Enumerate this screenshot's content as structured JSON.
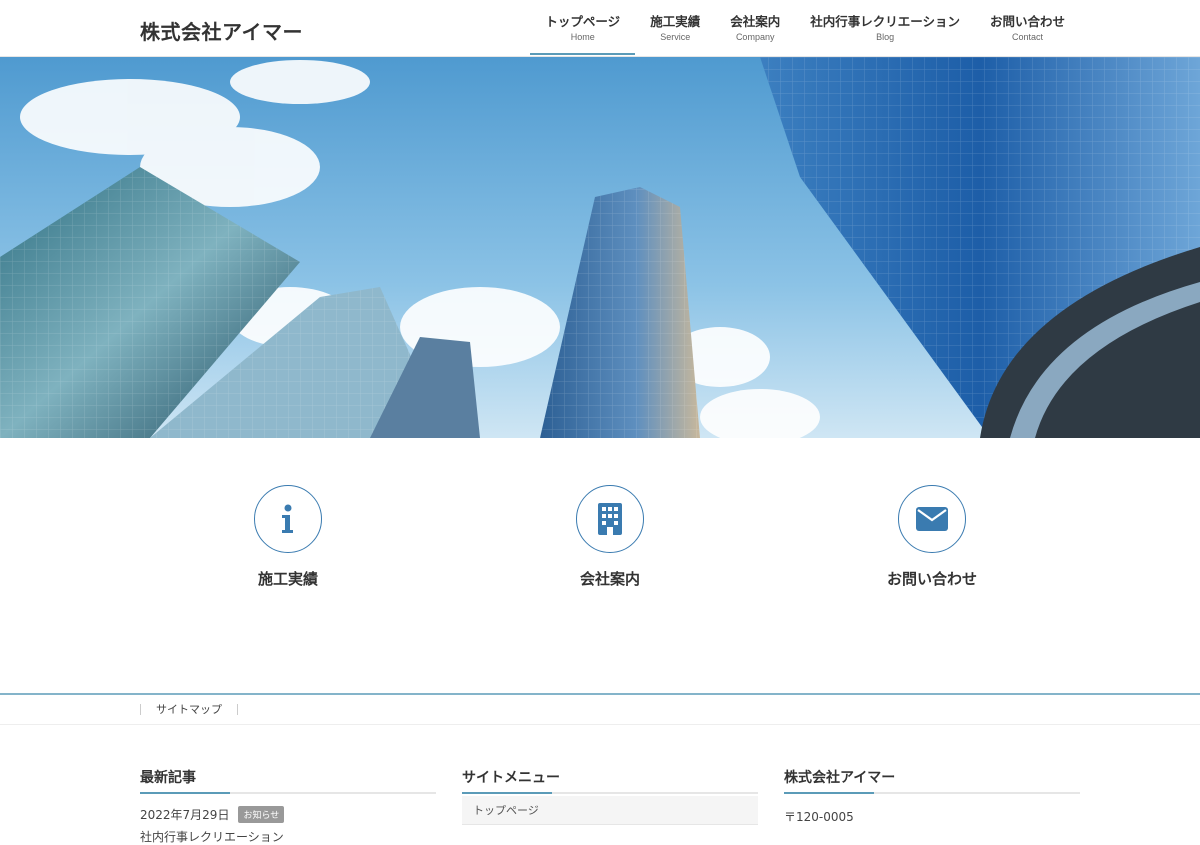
{
  "header": {
    "logo": "株式会社アイマー",
    "nav": [
      {
        "label": "トップページ",
        "sub": "Home"
      },
      {
        "label": "施工実績",
        "sub": "Service"
      },
      {
        "label": "会社案内",
        "sub": "Company"
      },
      {
        "label": "社内行事レクリエーション",
        "sub": "Blog"
      },
      {
        "label": "お問い合わせ",
        "sub": "Contact"
      }
    ]
  },
  "pr_blocks": [
    {
      "title": "施工実績",
      "icon": "info-icon"
    },
    {
      "title": "会社案内",
      "icon": "building-icon"
    },
    {
      "title": "お問い合わせ",
      "icon": "envelope-icon"
    }
  ],
  "footer_nav": {
    "sitemap": "サイトマップ"
  },
  "widgets": {
    "recent": {
      "title": "最新記事",
      "date": "2022年7月29日",
      "badge": "お知らせ",
      "post_title": "社内行事レクリエーション"
    },
    "site_menu": {
      "title": "サイトメニュー",
      "items": [
        "トップページ"
      ]
    },
    "company": {
      "title": "株式会社アイマー",
      "address": "〒120-0005"
    }
  },
  "colors": {
    "accent": "#5b9bb8",
    "icon": "#3a7bb0"
  }
}
